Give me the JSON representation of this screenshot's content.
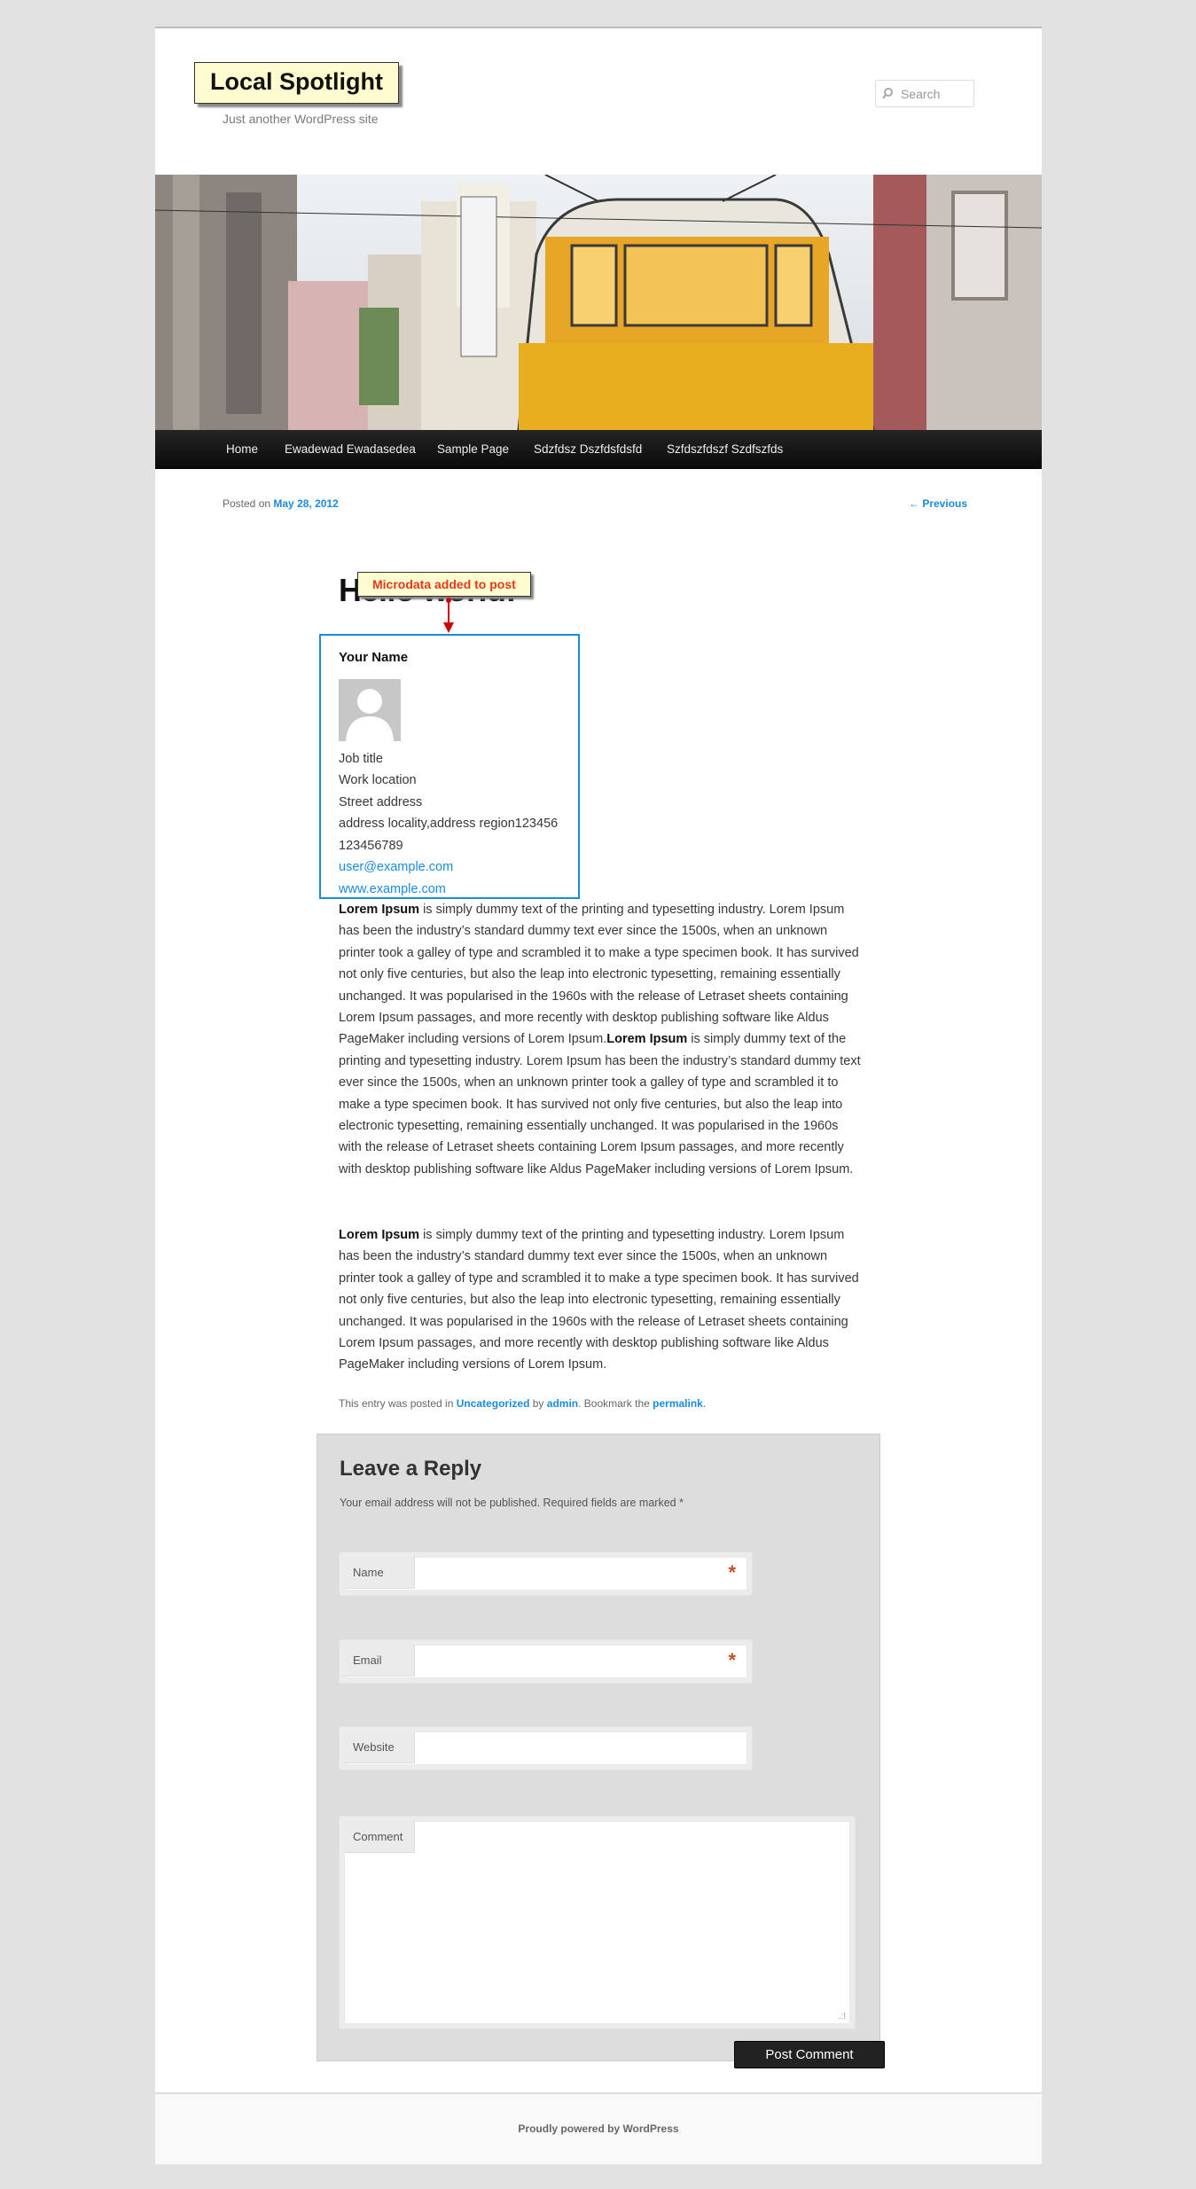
{
  "site": {
    "title": "Local Spotlight",
    "description": "Just another WordPress site"
  },
  "search": {
    "placeholder": "Search"
  },
  "nav": {
    "items": [
      "Home",
      "Ewadewad Ewadasedea",
      "Sample Page",
      "Sdzfdsz Dszfdsfdsfd",
      "Szfdszfdszf Szdfszfds"
    ]
  },
  "post": {
    "posted_prefix": "Posted on",
    "date": "May 28, 2012",
    "previous": "← Previous",
    "title": "Hello world!",
    "annotation": "Microdata added to post",
    "card": {
      "name": "Your Name",
      "job_title": "Job title",
      "work_location": "Work location",
      "street": "Street address",
      "locality": "address locality,address region123456",
      "phone": "123456789",
      "email": "user@example.com",
      "url": "www.example.com"
    },
    "para1_lead": "Lorem Ipsum",
    "para1_a": " is simply dummy text of the printing and typesetting industry. Lorem Ipsum has been the industry’s standard dummy text ever since the 1500s, when an unknown printer took a galley of type and scrambled it to make a type specimen book. It has survived not only five centuries, but also the leap into electronic typesetting, remaining essentially unchanged. It was popularised in the 1960s with the release of Letraset sheets containing Lorem Ipsum passages, and more recently with desktop publishing software like Aldus PageMaker including versions of Lorem Ipsum.",
    "para1_lead2": "Lorem Ipsum",
    "para1_b": " is simply dummy text of the printing and typesetting industry. Lorem Ipsum has been the industry’s standard dummy text ever since the 1500s, when an unknown printer took a galley of type and scrambled it to make a type specimen book. It has survived not only five centuries, but also the leap into electronic typesetting, remaining essentially unchanged. It was popularised in the 1960s with the release of Letraset sheets containing Lorem Ipsum passages, and more recently with desktop publishing software like Aldus PageMaker including versions of Lorem Ipsum.",
    "para2_lead": "Lorem Ipsum",
    "para2": " is simply dummy text of the printing and typesetting industry. Lorem Ipsum has been the industry’s standard dummy text ever since the 1500s, when an unknown printer took a galley of type and scrambled it to make a type specimen book. It has survived not only five centuries, but also the leap into electronic typesetting, remaining essentially unchanged. It was popularised in the 1960s with the release of Letraset sheets containing Lorem Ipsum passages, and more recently with desktop publishing software like Aldus PageMaker including versions of Lorem Ipsum.",
    "meta_prefix": "This entry was posted in ",
    "category": "Uncategorized",
    "meta_by": " by ",
    "author": "admin",
    "meta_bookmark": ". Bookmark the ",
    "permalink": "permalink",
    "meta_end": "."
  },
  "reply": {
    "heading": "Leave a Reply",
    "note": "Your email address will not be published. Required fields are marked *",
    "name_label": "Name",
    "email_label": "Email",
    "website_label": "Website",
    "comment_label": "Comment",
    "required_mark": "*",
    "submit": "Post Comment"
  },
  "footer": {
    "text": "Proudly powered by WordPress"
  },
  "colors": {
    "link": "#1b8be0",
    "annotation": "#e4391b",
    "nav_bg": "#111111"
  }
}
